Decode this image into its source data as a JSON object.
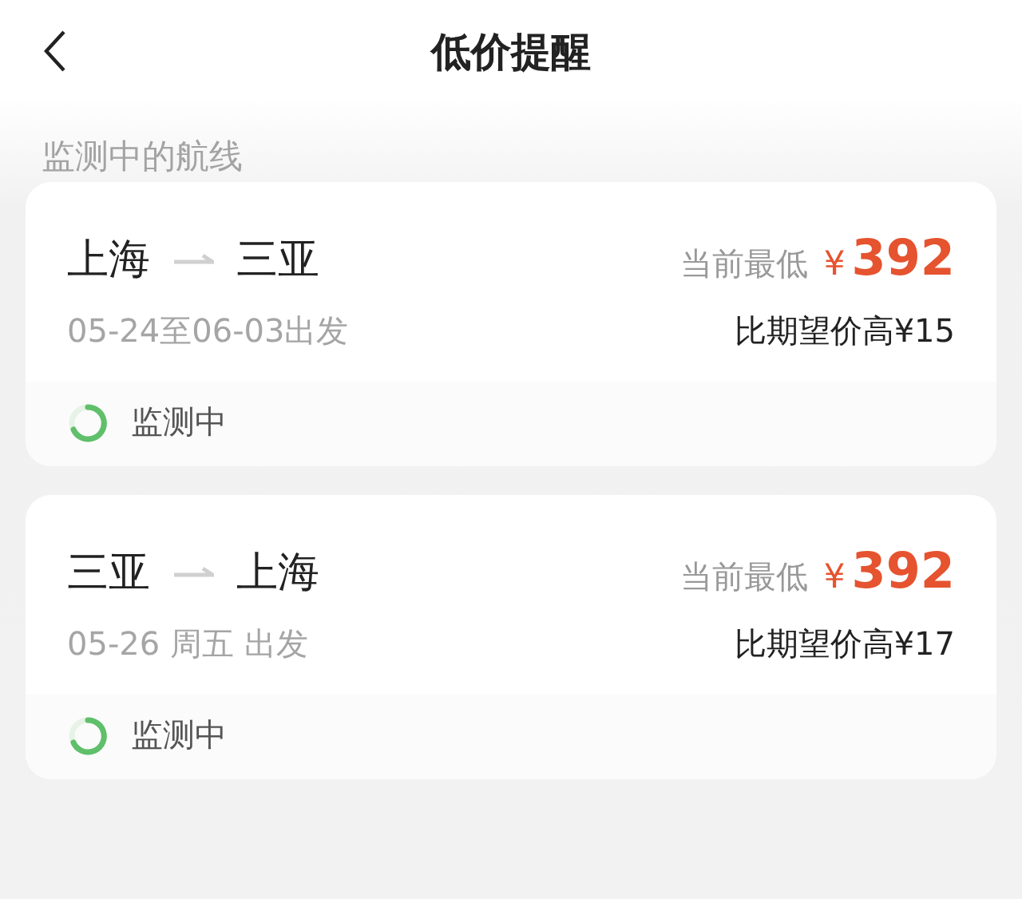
{
  "header": {
    "title": "低价提醒"
  },
  "section_label": "监测中的航线",
  "routes": [
    {
      "origin": "上海",
      "destination": "三亚",
      "price_label": "当前最低",
      "currency": "¥",
      "price": "392",
      "dates": "05-24至06-03出发",
      "compare": "比期望价高¥15",
      "status": "监测中"
    },
    {
      "origin": "三亚",
      "destination": "上海",
      "price_label": "当前最低",
      "currency": "¥",
      "price": "392",
      "dates": "05-26 周五 出发",
      "compare": "比期望价高¥17",
      "status": "监测中"
    }
  ]
}
